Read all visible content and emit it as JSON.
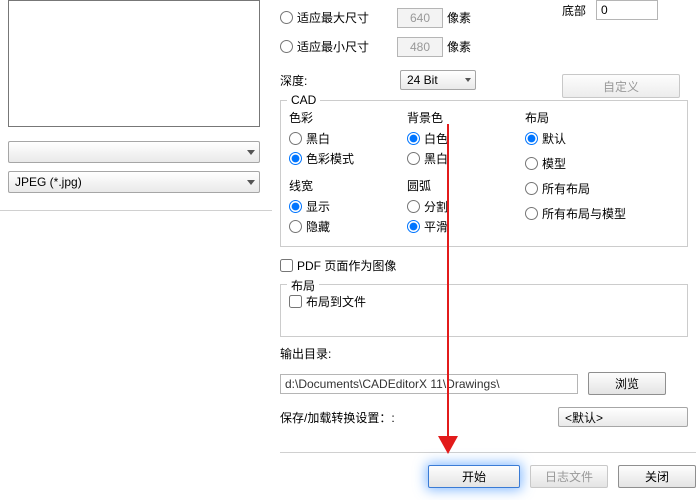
{
  "left": {
    "dropdown1": "",
    "dropdown2": "JPEG (*.jpg)"
  },
  "size": {
    "max_label": "适应最大尺寸",
    "max_value": "640",
    "min_label": "适应最小尺寸",
    "min_value": "480",
    "unit": "像素"
  },
  "depth": {
    "label": "深度:",
    "value": "24 Bit"
  },
  "side": {
    "bottom_label": "底部",
    "bottom_value": "0",
    "custom_btn": "自定义"
  },
  "cad": {
    "legend": "CAD",
    "color": {
      "title": "色彩",
      "bw": "黑白",
      "color_mode": "色彩模式"
    },
    "bgcolor": {
      "title": "背景色",
      "white": "白色",
      "black": "黑白"
    },
    "layout": {
      "title": "布局",
      "default": "默认",
      "model": "模型",
      "all": "所有布局",
      "all_model": "所有布局与模型"
    },
    "linewidth": {
      "title": "线宽",
      "show": "显示",
      "hide": "隐藏"
    },
    "arc": {
      "title": "圆弧",
      "split": "分割",
      "smooth": "平滑"
    }
  },
  "pdf_checkbox": "PDF 页面作为图像",
  "layout_fs": {
    "legend": "布局",
    "to_file": "布局到文件"
  },
  "output": {
    "label": "输出目录:",
    "path": "d:\\Documents\\CADEditorX 11\\Drawings\\",
    "browse": "浏览"
  },
  "settings": {
    "label": "保存/加载转换设置：:",
    "value": "<默认>"
  },
  "footer": {
    "start": "开始",
    "log": "日志文件",
    "close": "关闭"
  }
}
